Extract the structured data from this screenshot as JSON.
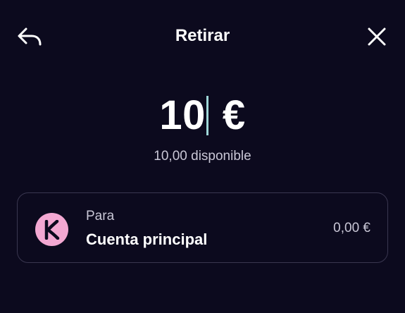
{
  "header": {
    "title": "Retirar",
    "back_icon": "back-arrow-icon",
    "close_icon": "close-icon"
  },
  "amount": {
    "value": "10",
    "currency": "€"
  },
  "available": {
    "text": "10,00 disponible"
  },
  "destination": {
    "label": "Para",
    "account_name": "Cuenta principal",
    "balance": "0,00 €",
    "logo_letter": "K",
    "logo_color": "#f3a8d2"
  },
  "colors": {
    "background": "#0c0a1e",
    "text_primary": "#ffffff",
    "text_secondary": "#c9c7d6",
    "caret": "#9fd7d8",
    "card_border": "#3a3750"
  }
}
